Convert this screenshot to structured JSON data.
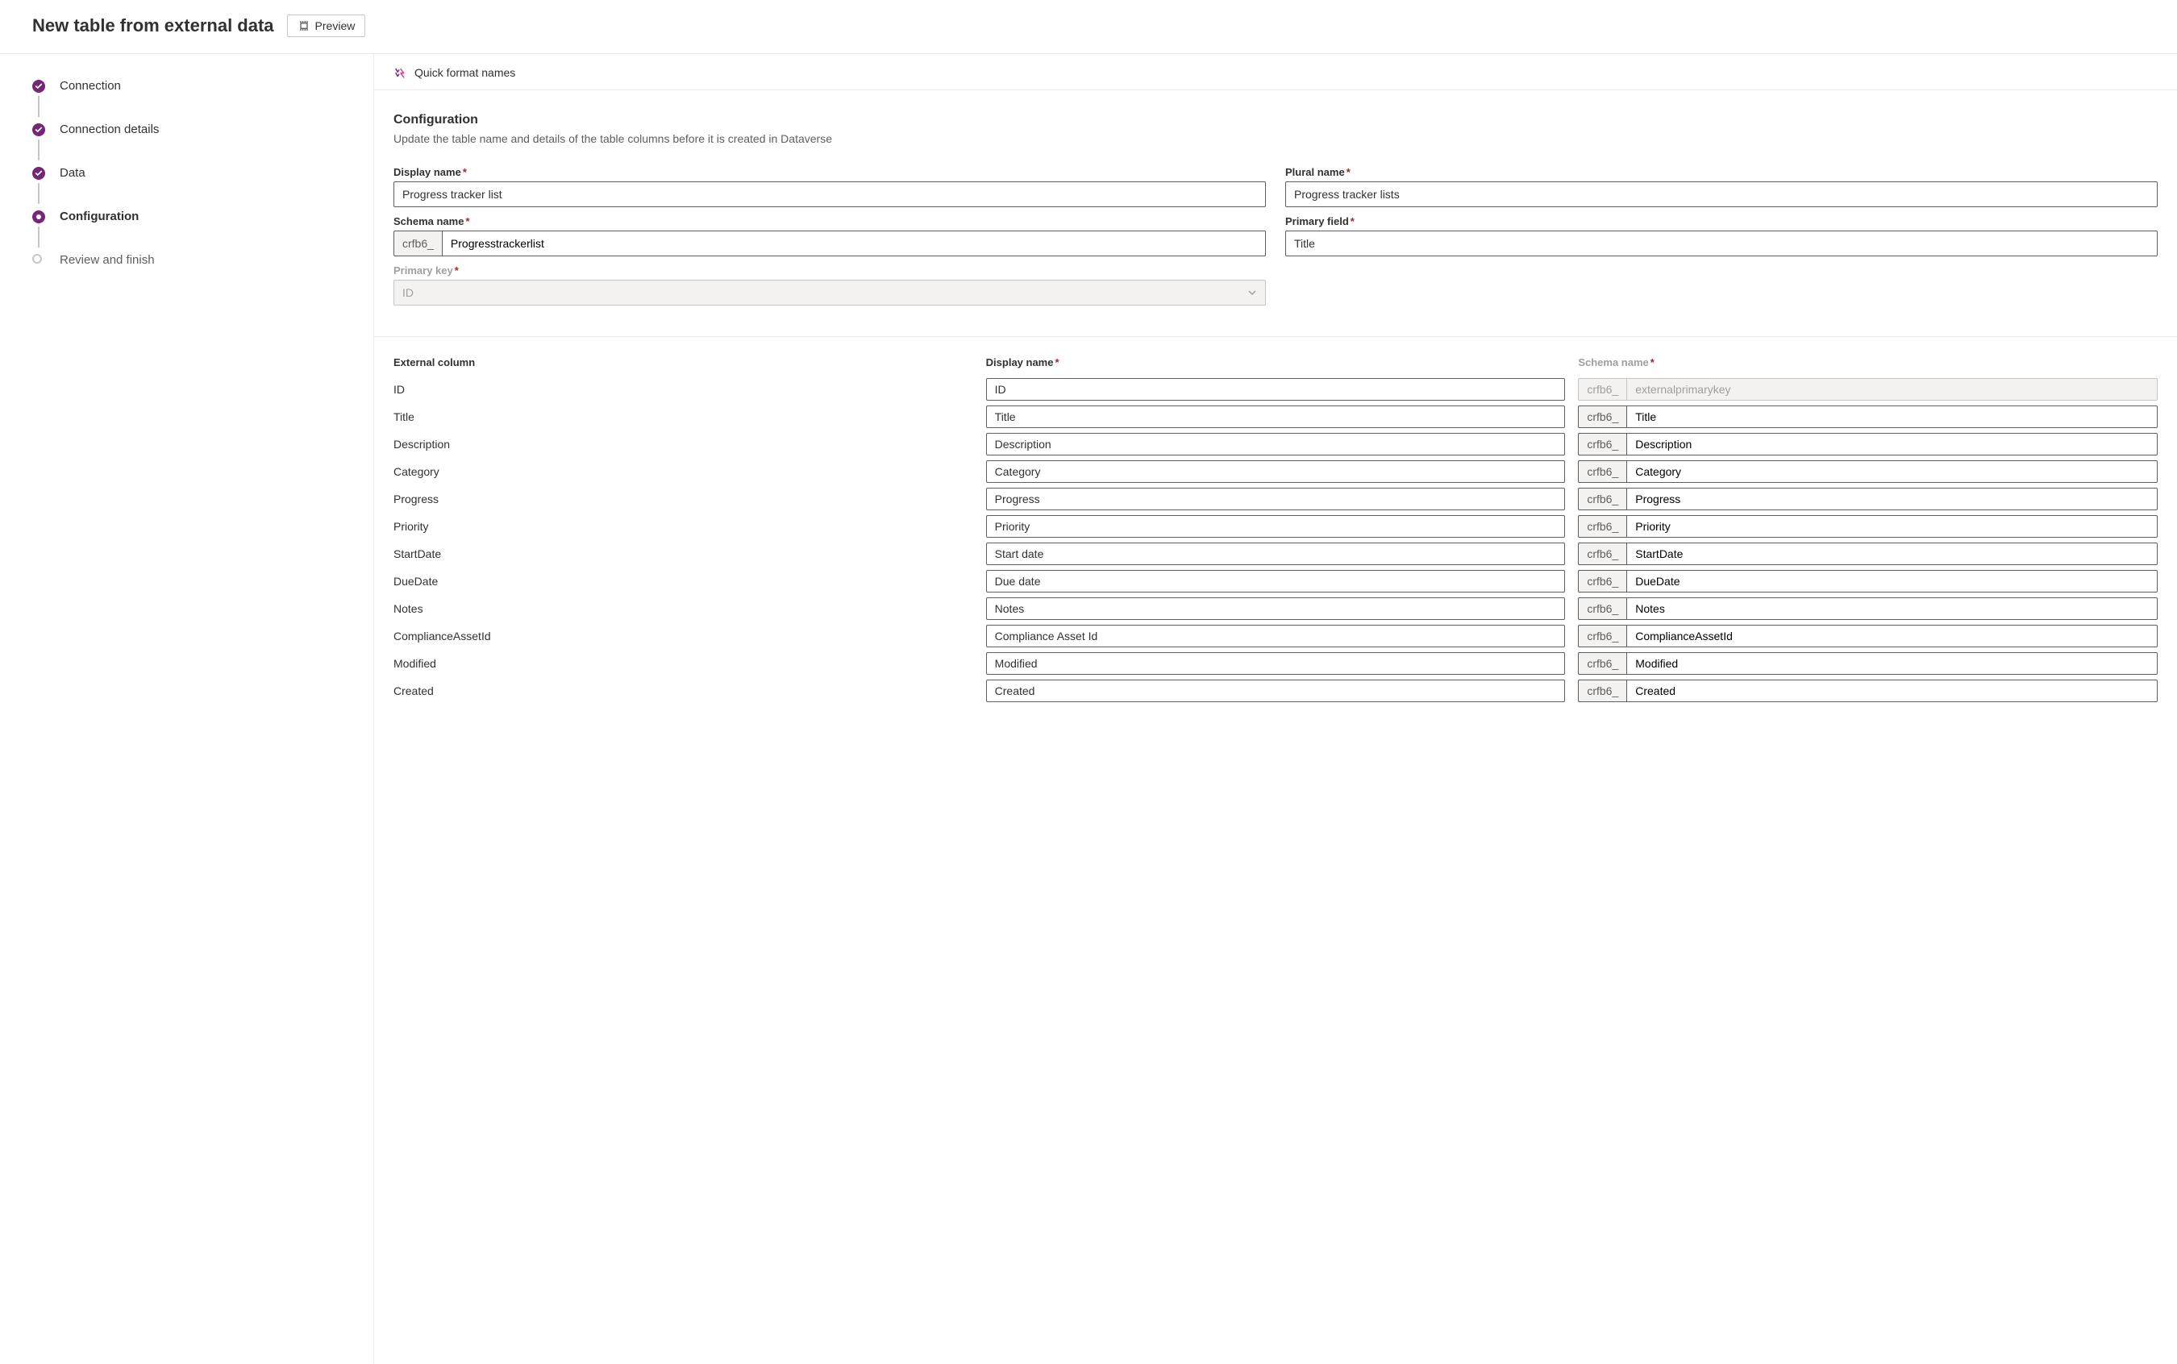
{
  "header": {
    "title": "New table from external data",
    "preview_label": "Preview"
  },
  "steps": [
    {
      "label": "Connection",
      "state": "done"
    },
    {
      "label": "Connection details",
      "state": "done"
    },
    {
      "label": "Data",
      "state": "done"
    },
    {
      "label": "Configuration",
      "state": "active"
    },
    {
      "label": "Review and finish",
      "state": "pending"
    }
  ],
  "toolbar": {
    "quick_format_label": "Quick format names"
  },
  "config": {
    "heading": "Configuration",
    "subtitle": "Update the table name and details of the table columns before it is created in Dataverse",
    "labels": {
      "display_name": "Display name",
      "plural_name": "Plural name",
      "schema_name": "Schema name",
      "primary_field": "Primary field",
      "primary_key": "Primary key"
    },
    "values": {
      "display_name": "Progress tracker list",
      "plural_name": "Progress tracker lists",
      "schema_prefix": "crfb6_",
      "schema_name": "Progresstrackerlist",
      "primary_field": "Title",
      "primary_key": "ID"
    }
  },
  "columns": {
    "headers": {
      "external": "External column",
      "display": "Display name",
      "schema": "Schema name"
    },
    "prefix": "crfb6_",
    "rows": [
      {
        "external": "ID",
        "display": "ID",
        "schema": "externalprimarykey",
        "locked": true
      },
      {
        "external": "Title",
        "display": "Title",
        "schema": "Title",
        "locked": false
      },
      {
        "external": "Description",
        "display": "Description",
        "schema": "Description",
        "locked": false
      },
      {
        "external": "Category",
        "display": "Category",
        "schema": "Category",
        "locked": false
      },
      {
        "external": "Progress",
        "display": "Progress",
        "schema": "Progress",
        "locked": false
      },
      {
        "external": "Priority",
        "display": "Priority",
        "schema": "Priority",
        "locked": false
      },
      {
        "external": "StartDate",
        "display": "Start date",
        "schema": "StartDate",
        "locked": false
      },
      {
        "external": "DueDate",
        "display": "Due date",
        "schema": "DueDate",
        "locked": false
      },
      {
        "external": "Notes",
        "display": "Notes",
        "schema": "Notes",
        "locked": false
      },
      {
        "external": "ComplianceAssetId",
        "display": "Compliance Asset Id",
        "schema": "ComplianceAssetId",
        "locked": false
      },
      {
        "external": "Modified",
        "display": "Modified",
        "schema": "Modified",
        "locked": false
      },
      {
        "external": "Created",
        "display": "Created",
        "schema": "Created",
        "locked": false
      }
    ]
  }
}
